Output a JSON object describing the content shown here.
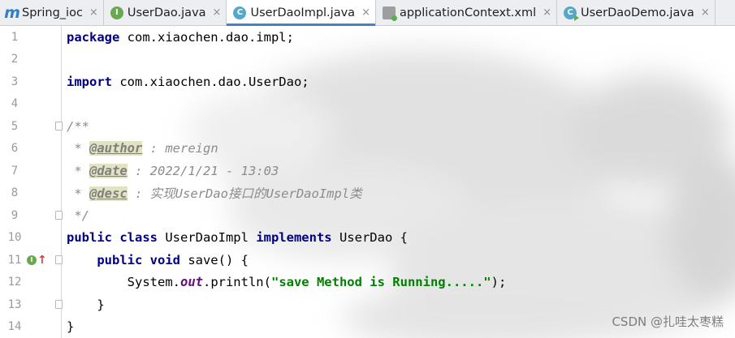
{
  "tabs": [
    {
      "label": "Spring_ioc",
      "icon": "maven-module-icon",
      "active": false
    },
    {
      "label": "UserDao.java",
      "icon": "interface-icon",
      "active": false
    },
    {
      "label": "UserDaoImpl.java",
      "icon": "class-icon",
      "active": true
    },
    {
      "label": "applicationContext.xml",
      "icon": "xml-file-icon",
      "active": false
    },
    {
      "label": "UserDaoDemo.java",
      "icon": "runnable-class-icon",
      "active": false
    }
  ],
  "close_glyph": "×",
  "editor": {
    "lines": [
      {
        "num": "1",
        "code": "package com.xiaochen.dao.impl;"
      },
      {
        "num": "2",
        "code": ""
      },
      {
        "num": "3",
        "code": "import com.xiaochen.dao.UserDao;"
      },
      {
        "num": "4",
        "code": ""
      },
      {
        "num": "5",
        "code": "/**"
      },
      {
        "num": "6",
        "code": " * @author : mereign"
      },
      {
        "num": "7",
        "code": " * @date : 2022/1/21 - 13:03"
      },
      {
        "num": "8",
        "code": " * @desc : 实现UserDao接口的UserDaoImpl类"
      },
      {
        "num": "9",
        "code": " */"
      },
      {
        "num": "10",
        "code": "public class UserDaoImpl implements UserDao {"
      },
      {
        "num": "11",
        "code": "    public void save() {"
      },
      {
        "num": "12",
        "code": "        System.out.println(\"save Method is Running.....\");"
      },
      {
        "num": "13",
        "code": "    }"
      },
      {
        "num": "14",
        "code": "}"
      }
    ],
    "line11_markers": {
      "impl_icon_letter": "I",
      "arrow_glyph": "↑"
    }
  },
  "watermark": "CSDN @扎哇太枣糕",
  "colors": {
    "keyword": "#000080",
    "comment": "#8c8c8c",
    "string": "#008000",
    "field": "#660e7a",
    "tab_accent": "#4083c9"
  }
}
